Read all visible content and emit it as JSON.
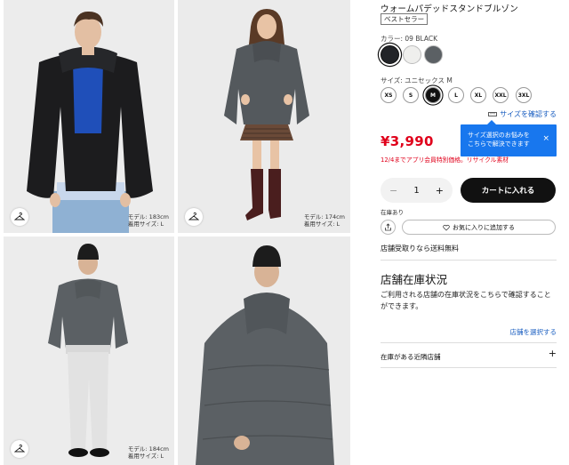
{
  "gallery": {
    "photos": [
      {
        "model_height": "モデル: 183cm",
        "model_size": "着用サイズ: L"
      },
      {
        "model_height": "モデル: 174cm",
        "model_size": "着用サイズ: L"
      },
      {
        "model_height": "",
        "model_size": ""
      },
      {
        "model_height": "モデル: 184cm",
        "model_size": "着用サイズ: L"
      }
    ],
    "icon": "hanger-icon"
  },
  "product": {
    "title": "ウォームパデッドスタンドブルゾン",
    "badge": "ベストセラー",
    "color_label": "カラー: 09 BLACK",
    "colors": [
      {
        "name": "BLACK",
        "hex": "#222428",
        "selected": true
      },
      {
        "name": "WHITE",
        "hex": "#efefed",
        "selected": false
      },
      {
        "name": "GRAY",
        "hex": "#5b6064",
        "selected": false
      }
    ],
    "size_label": "サイズ: ユニセックス M",
    "sizes": [
      "XS",
      "S",
      "M",
      "L",
      "XL",
      "XXL",
      "3XL"
    ],
    "selected_size": "M",
    "size_check_link": "サイズを確認する",
    "tooltip_line1": "サイズ選択のお悩みを",
    "tooltip_line2": "こちらで解決できます",
    "tooltip_close": "×",
    "price": "¥3,990",
    "promo_text": "12/4までアプリ会員特別価格。リサイクル素材",
    "quantity": "1",
    "qty_minus": "−",
    "qty_plus": "+",
    "cart_button": "カートに入れる",
    "stock_note": "在庫あり",
    "favorite_button": "お気に入りに追加する",
    "shipping_note": "店舗受取りなら送料無料"
  },
  "store": {
    "heading": "店舗在庫状況",
    "description": "ご利用される店舗の在庫状況をこちらで確認することができます。",
    "select_link": "店舗を選択する",
    "nearby_label": "在庫がある近隣店舗",
    "expand_icon": "+"
  },
  "colors": {
    "accent_red": "#e0001b",
    "link_blue": "#1b5fc1",
    "tooltip_blue": "#1877ee",
    "cart_black": "#111111"
  }
}
